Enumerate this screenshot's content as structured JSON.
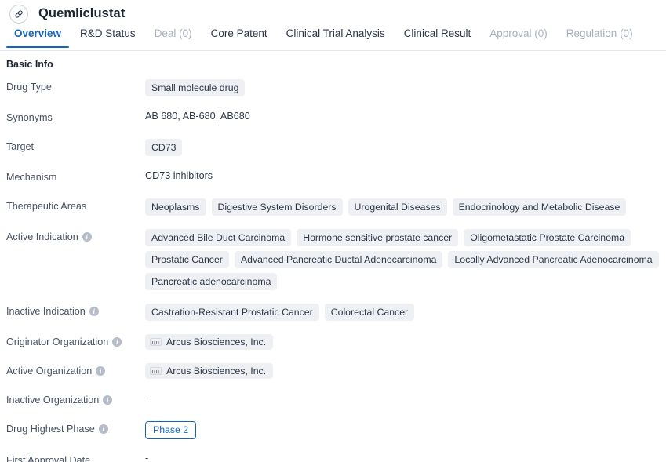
{
  "header": {
    "icon": "pill-capsule-icon",
    "title": "Quemliclustat"
  },
  "tabs": [
    {
      "label": "Overview",
      "state": "active"
    },
    {
      "label": "R&D Status",
      "state": "normal"
    },
    {
      "label": "Deal (0)",
      "state": "muted"
    },
    {
      "label": "Core Patent",
      "state": "normal"
    },
    {
      "label": "Clinical Trial Analysis",
      "state": "normal"
    },
    {
      "label": "Clinical Result",
      "state": "normal"
    },
    {
      "label": "Approval (0)",
      "state": "muted"
    },
    {
      "label": "Regulation (0)",
      "state": "muted"
    }
  ],
  "section": {
    "title": "Basic Info"
  },
  "info_tooltip_glyph": "i",
  "rows": [
    {
      "label": "Drug Type",
      "has_info": false,
      "type": "tags",
      "values": [
        "Small molecule drug"
      ]
    },
    {
      "label": "Synonyms",
      "has_info": false,
      "type": "text",
      "text": "AB 680,  AB-680,  AB680"
    },
    {
      "label": "Target",
      "has_info": false,
      "type": "tags",
      "values": [
        "CD73"
      ]
    },
    {
      "label": "Mechanism",
      "has_info": false,
      "type": "text",
      "text": "CD73 inhibitors"
    },
    {
      "label": "Therapeutic Areas",
      "has_info": false,
      "type": "tags",
      "values": [
        "Neoplasms",
        "Digestive System Disorders",
        "Urogenital Diseases",
        "Endocrinology and Metabolic Disease"
      ]
    },
    {
      "label": "Active Indication",
      "has_info": true,
      "type": "tags",
      "values": [
        "Advanced Bile Duct Carcinoma",
        "Hormone sensitive prostate cancer",
        "Oligometastatic Prostate Carcinoma",
        "Prostatic Cancer",
        "Advanced Pancreatic Ductal Adenocarcinoma",
        "Locally Advanced Pancreatic Adenocarcinoma",
        "Pancreatic adenocarcinoma"
      ]
    },
    {
      "label": "Inactive Indication",
      "has_info": true,
      "type": "tags",
      "values": [
        "Castration-Resistant Prostatic Cancer",
        "Colorectal Cancer"
      ]
    },
    {
      "label": "Originator Organization",
      "has_info": true,
      "type": "org",
      "values": [
        "Arcus Biosciences, Inc."
      ]
    },
    {
      "label": "Active Organization",
      "has_info": true,
      "type": "org",
      "values": [
        "Arcus Biosciences, Inc."
      ]
    },
    {
      "label": "Inactive Organization",
      "has_info": true,
      "type": "empty",
      "text": "-"
    },
    {
      "label": "Drug Highest Phase",
      "has_info": true,
      "type": "phase",
      "text": "Phase 2"
    },
    {
      "label": "First Approval Date",
      "has_info": false,
      "type": "empty",
      "text": "-"
    }
  ],
  "colors": {
    "accent": "#1565c0",
    "tag_bg": "#eef0f3",
    "text": "#2c3648",
    "muted": "#a8afbc"
  }
}
